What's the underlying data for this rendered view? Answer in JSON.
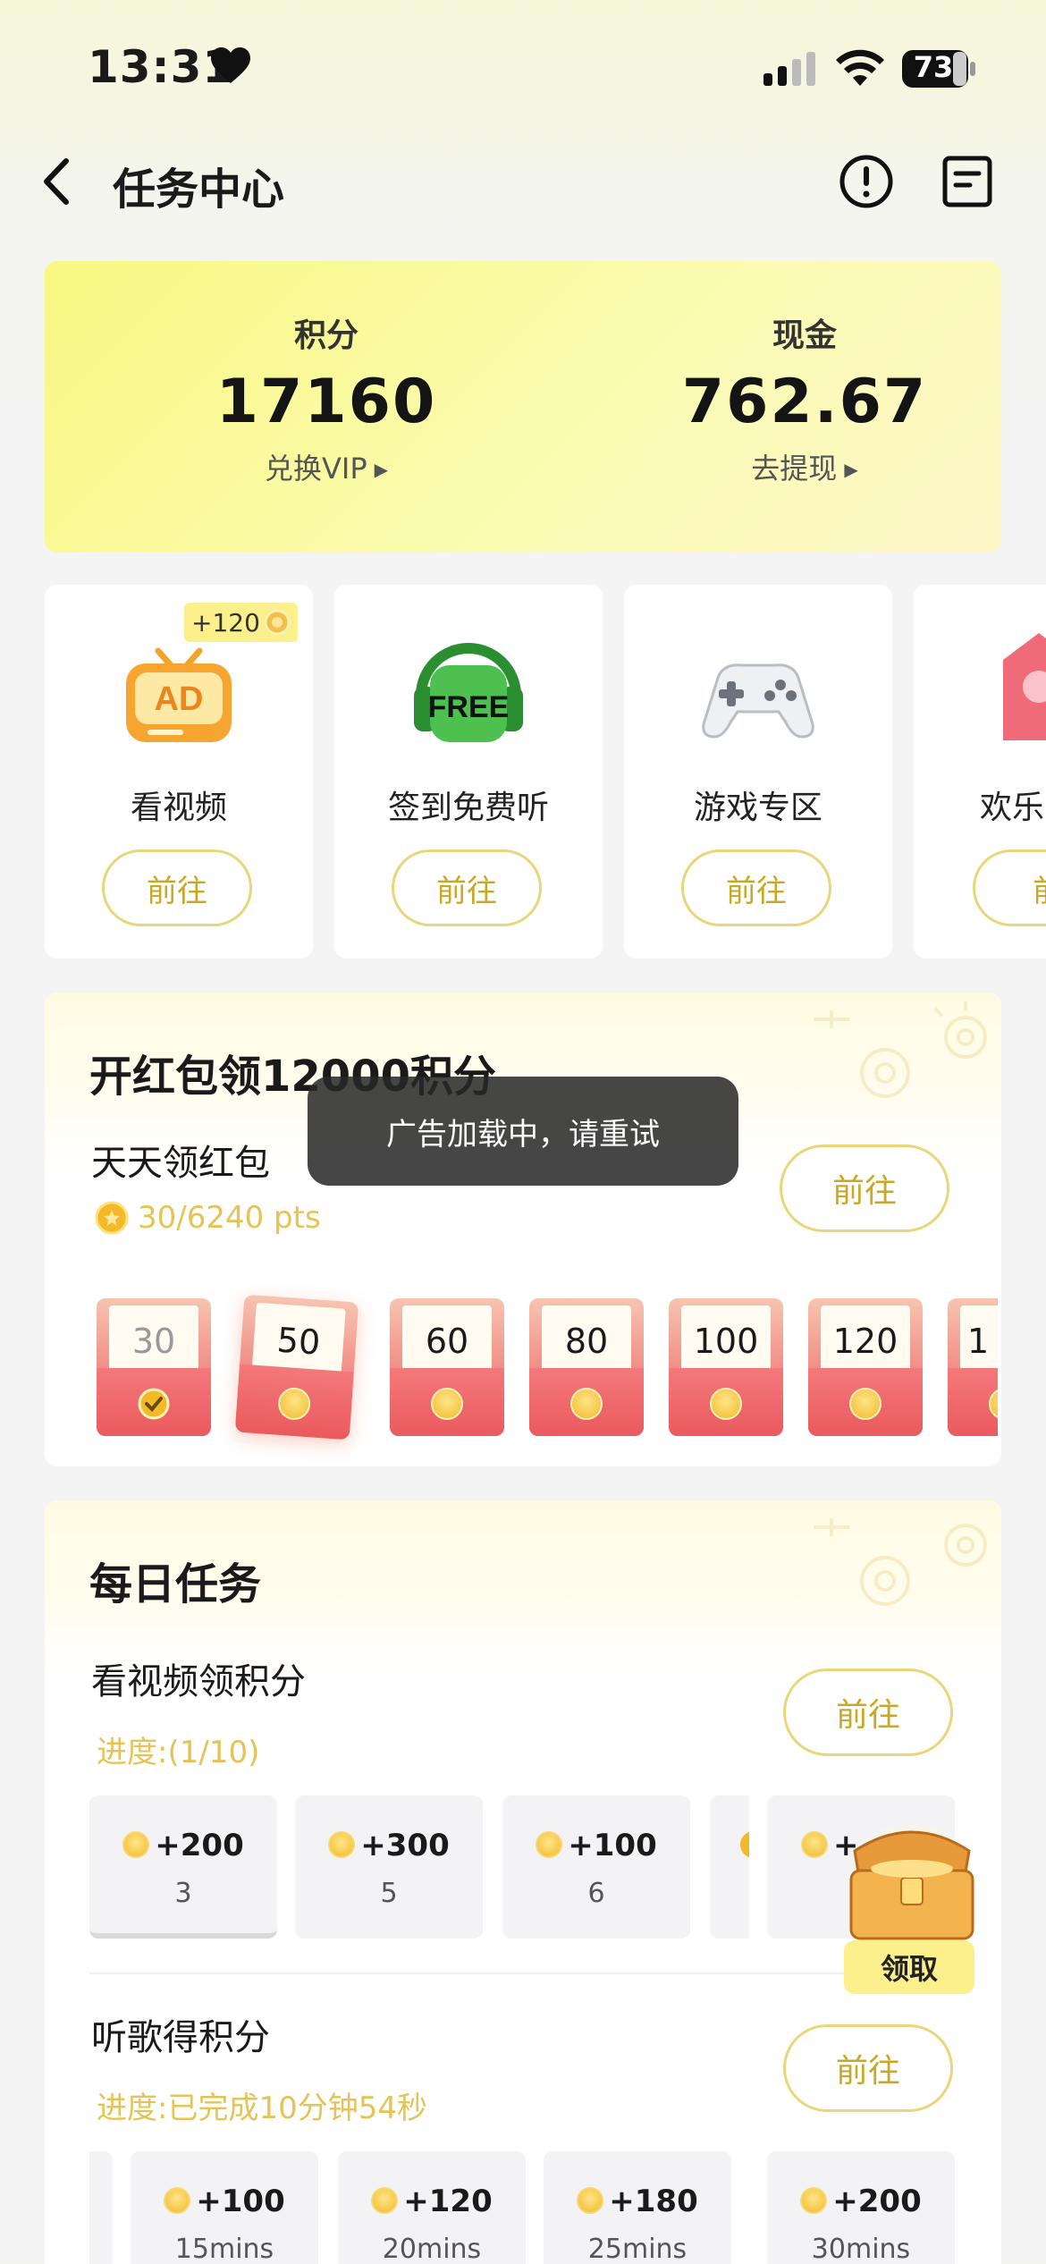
{
  "status_bar": {
    "time": "13:31",
    "battery": "73"
  },
  "nav": {
    "title": "任务中心"
  },
  "points_card": {
    "points_label": "积分",
    "points_value": "17160",
    "points_link": "兑换VIP",
    "cash_label": "现金",
    "cash_value": "762.67",
    "cash_link": "去提现"
  },
  "quick_cards": [
    {
      "label": "看视频",
      "button": "前往",
      "badge": "+120",
      "icon": "ad-tv-icon"
    },
    {
      "label": "签到免费听",
      "button": "前往",
      "icon": "free-headphones-icon"
    },
    {
      "label": "游戏专区",
      "button": "前往",
      "icon": "gamepad-icon"
    },
    {
      "label": "欢乐",
      "button": "前",
      "icon": "red-tag-icon"
    }
  ],
  "red_packet": {
    "title": "开红包领12000积分",
    "subtitle": "天天领红包",
    "progress": "30/6240 pts",
    "button": "前往",
    "envelopes": [
      "30",
      "50",
      "60",
      "80",
      "100",
      "120",
      "1"
    ]
  },
  "toast": "广告加载中，请重试",
  "daily_tasks": {
    "title": "每日任务",
    "video_task": {
      "title": "看视频领积分",
      "progress": "进度:(1/10)",
      "button": "前往",
      "tiles": [
        {
          "amount": "+200",
          "sub": "3"
        },
        {
          "amount": "+300",
          "sub": "5"
        },
        {
          "amount": "+100",
          "sub": "6"
        },
        {
          "amount": "",
          "sub": ""
        },
        {
          "amount": "+",
          "sub": ""
        }
      ]
    },
    "music_task": {
      "title": "听歌得积分",
      "progress": "进度:已完成10分钟54秒",
      "button": "前往",
      "tiles": [
        {
          "amount": "+100",
          "sub": "15mins"
        },
        {
          "amount": "+120",
          "sub": "20mins"
        },
        {
          "amount": "+180",
          "sub": "25mins"
        },
        {
          "amount": "+200",
          "sub": "30mins"
        }
      ]
    },
    "claim_label": "领取"
  }
}
